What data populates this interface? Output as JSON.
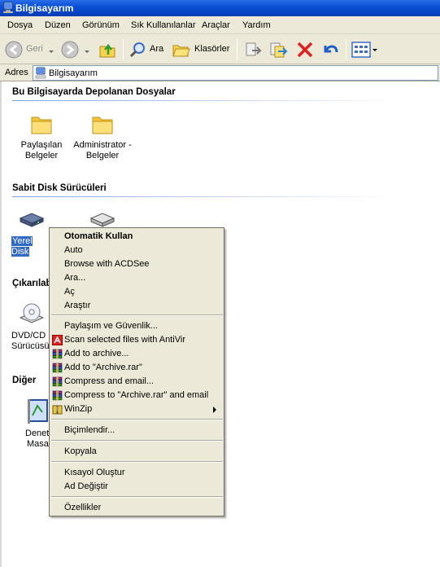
{
  "window": {
    "title": "Bilgisayarım"
  },
  "menubar": [
    "Dosya",
    "Düzen",
    "Görünüm",
    "Sık Kullanılanlar",
    "Araçlar",
    "Yardım"
  ],
  "toolbar": {
    "back_label": "Geri",
    "search_label": "Ara",
    "folders_label": "Klasörler"
  },
  "address": {
    "label": "Adres",
    "value": "Bilgisayarım"
  },
  "sections": {
    "stored_files": {
      "title": "Bu Bilgisayarda Depolanan Dosyalar",
      "items": [
        {
          "line1": "Paylaşılan",
          "line2": "Belgeler"
        },
        {
          "line1": "Administrator -",
          "line2": "Belgeler"
        }
      ]
    },
    "hard_drives": {
      "title": "Sabit Disk Sürücüleri",
      "selected_caption": "Yerel Disk"
    },
    "removable": {
      "title": "Çıkarılabilir",
      "item_line1": "DVD/CD",
      "item_line2": "Sürücüsü"
    },
    "other": {
      "title": "Diğer",
      "item_line1": "Denet",
      "item_line2": "Masa"
    }
  },
  "context_menu": {
    "items": [
      {
        "label": "Otomatik Kullan",
        "bold": true
      },
      {
        "label": "Auto"
      },
      {
        "label": "Browse with ACDSee"
      },
      {
        "label": "Ara..."
      },
      {
        "label": "Aç"
      },
      {
        "label": "Araştır"
      },
      {
        "label": "Paylaşım ve Güvenlik..."
      },
      {
        "label": "Scan selected files with AntiVir",
        "icon": "antivir-icon"
      },
      {
        "label": "Add to archive...",
        "icon": "winrar-icon"
      },
      {
        "label": "Add to \"Archive.rar\"",
        "icon": "winrar-icon"
      },
      {
        "label": "Compress and email...",
        "icon": "winrar-icon"
      },
      {
        "label": "Compress to \"Archive.rar\" and email",
        "icon": "winrar-icon"
      },
      {
        "label": "WinZip",
        "icon": "winzip-icon",
        "submenu": true
      },
      {
        "label": "Biçimlendir..."
      },
      {
        "label": "Kopyala"
      },
      {
        "label": "Kısayol Oluştur"
      },
      {
        "label": "Ad Değiştir"
      },
      {
        "label": "Özellikler"
      }
    ]
  },
  "colors": {
    "titlebar": "#0a4fd6",
    "selection": "#316ac5",
    "menu_bg": "#ece9d8",
    "delete_red": "#e02020"
  }
}
